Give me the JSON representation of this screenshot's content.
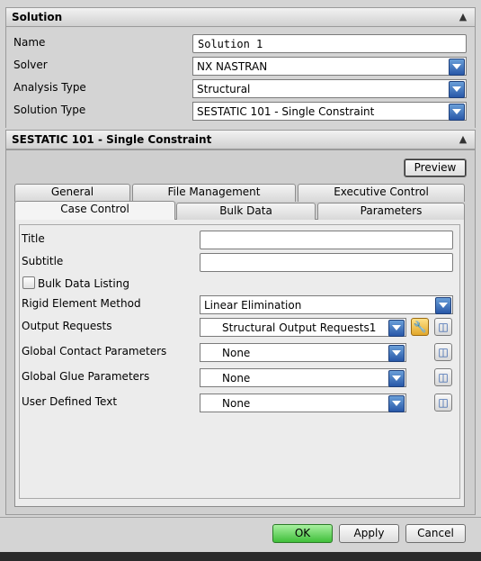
{
  "solution_section": {
    "title": "Solution",
    "name_label": "Name",
    "name_value": "Solution 1",
    "solver_label": "Solver",
    "solver_value": "NX NASTRAN",
    "analysis_type_label": "Analysis Type",
    "analysis_type_value": "Structural",
    "solution_type_label": "Solution Type",
    "solution_type_value": "SESTATIC 101 - Single Constraint"
  },
  "sestatic_section": {
    "title": "SESTATIC 101 - Single Constraint",
    "preview_label": "Preview",
    "tabs_row1": [
      "General",
      "File Management",
      "Executive Control"
    ],
    "tabs_row2": [
      "Case Control",
      "Bulk Data",
      "Parameters"
    ],
    "active_tab": "Case Control"
  },
  "case_control": {
    "title_label": "Title",
    "title_value": "",
    "subtitle_label": "Subtitle",
    "subtitle_value": "",
    "bulk_data_listing_label": "Bulk Data Listing",
    "bulk_data_listing_checked": false,
    "rigid_element_label": "Rigid Element Method",
    "rigid_element_value": "Linear Elimination",
    "output_requests_label": "Output Requests",
    "output_requests_value": "Structural Output Requests1",
    "global_contact_label": "Global Contact Parameters",
    "global_contact_value": "None",
    "global_glue_label": "Global Glue Parameters",
    "global_glue_value": "None",
    "user_defined_label": "User Defined Text",
    "user_defined_value": "None"
  },
  "footer": {
    "ok_label": "OK",
    "apply_label": "Apply",
    "cancel_label": "Cancel"
  },
  "colors": {
    "ok_button": "#3fbf3a",
    "dropdown_arrow": "#2858a8",
    "background": "#d4d4d4"
  }
}
